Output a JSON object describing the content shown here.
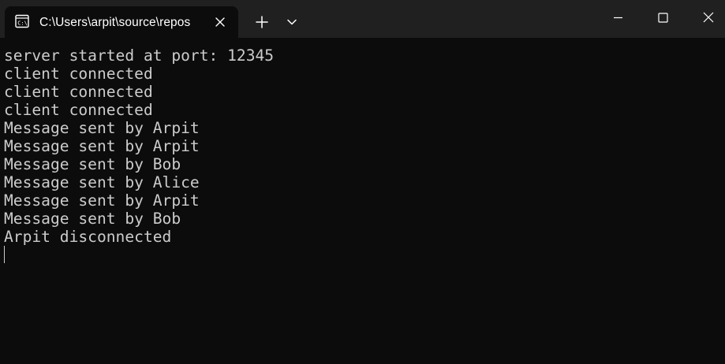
{
  "tab": {
    "title": "C:\\Users\\arpit\\source\\repos",
    "icon": "terminal-cmd-icon"
  },
  "icons": {
    "tab_close": "close-icon",
    "new_tab": "plus-icon",
    "dropdown": "chevron-down-icon",
    "minimize": "minimize-icon",
    "maximize": "maximize-icon",
    "close": "close-icon"
  },
  "colors": {
    "titlebar_bg": "#202020",
    "terminal_bg": "#0c0c0c",
    "text": "#cccccc",
    "title_text": "#ffffff"
  },
  "terminal": {
    "lines": [
      "server started at port: 12345",
      "client connected",
      "client connected",
      "client connected",
      "Message sent by Arpit",
      "Message sent by Arpit",
      "Message sent by Bob",
      "Message sent by Alice",
      "Message sent by Arpit",
      "Message sent by Bob",
      "Arpit disconnected"
    ]
  }
}
